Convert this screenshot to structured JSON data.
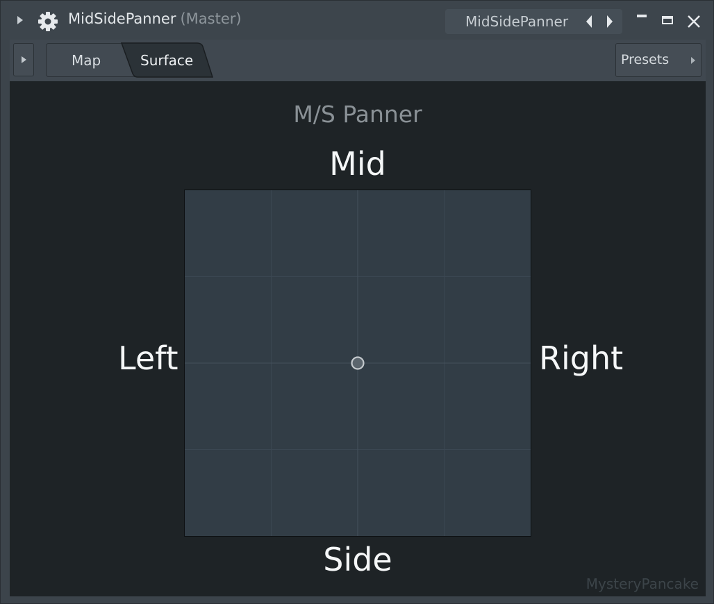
{
  "titlebar": {
    "plugin_title": "MidSidePanner",
    "channel": "(Master)",
    "plugin_selector": "MidSidePanner"
  },
  "toolbar": {
    "tabs": [
      {
        "label": "Map",
        "active": false
      },
      {
        "label": "Surface",
        "active": true
      }
    ],
    "presets_label": "Presets"
  },
  "panel": {
    "title": "M/S Panner",
    "labels": {
      "top": "Mid",
      "bottom": "Side",
      "left": "Left",
      "right": "Right"
    },
    "handle": {
      "x": 0,
      "y": 0
    },
    "watermark": "MysteryPancake"
  },
  "colors": {
    "window_bg": "#3c444b",
    "panel_bg": "#1e2326",
    "pad_bg": "#323d46",
    "text": "#f5f7f8"
  }
}
